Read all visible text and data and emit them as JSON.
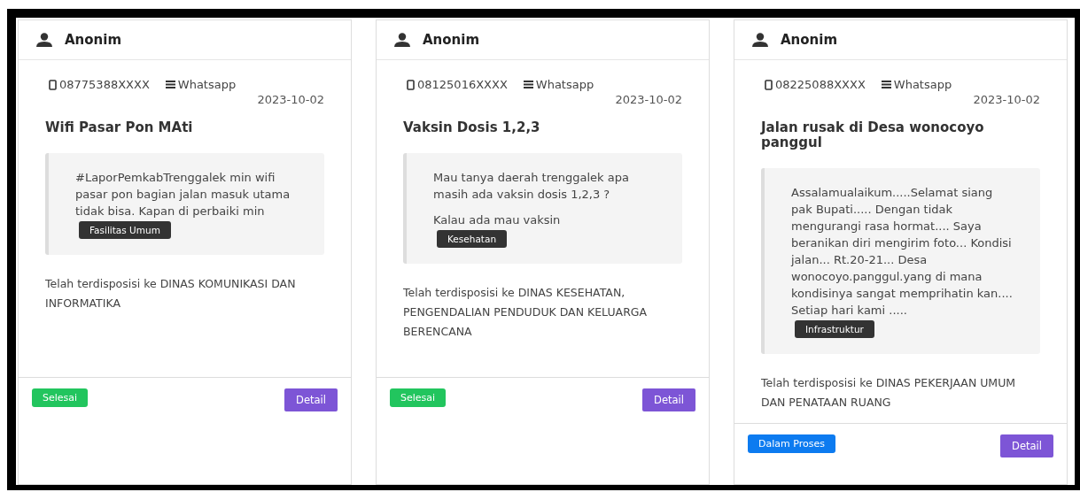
{
  "cards": [
    {
      "author": "Anonim",
      "phone": "08775388XXXX",
      "channel": "Whatsapp",
      "date": "2023-10-02",
      "title": "Wifi Pasar Pon MAti",
      "message": [
        "#LaporPemkabTrenggalek min wifi pasar pon bagian jalan masuk utama tidak bisa. Kapan di perbaiki min"
      ],
      "category": "Fasilitas Umum",
      "disposition": "Telah terdisposisi ke DINAS KOMUNIKASI DAN INFORMATIKA",
      "status": {
        "label": "Selesai",
        "kind": "done"
      },
      "action": "Detail"
    },
    {
      "author": "Anonim",
      "phone": "08125016XXXX",
      "channel": "Whatsapp",
      "date": "2023-10-02",
      "title": "Vaksin Dosis 1,2,3",
      "message": [
        "Mau tanya daerah trenggalek apa masih ada vaksin dosis 1,2,3 ?",
        "Kalau ada mau vaksin"
      ],
      "category": "Kesehatan",
      "disposition": "Telah terdisposisi ke DINAS KESEHATAN, PENGENDALIAN PENDUDUK DAN KELUARGA BERENCANA",
      "status": {
        "label": "Selesai",
        "kind": "done"
      },
      "action": "Detail"
    },
    {
      "author": "Anonim",
      "phone": "08225088XXXX",
      "channel": "Whatsapp",
      "date": "2023-10-02",
      "title": "Jalan rusak di Desa wonocoyo panggul",
      "message": [
        "Assalamualaikum.....Selamat siang pak Bupati..... Dengan tidak mengurangi rasa hormat.... Saya beranikan diri mengirim foto... Kondisi jalan... Rt.20-21... Desa wonocoyo.panggul.yang di mana kondisinya sangat memprihatin kan.... Setiap hari kami ....."
      ],
      "category": "Infrastruktur",
      "disposition": "Telah terdisposisi ke DINAS PEKERJAAN UMUM DAN PENATAAN RUANG",
      "status": {
        "label": "Dalam Proses",
        "kind": "process"
      },
      "action": "Detail"
    }
  ]
}
